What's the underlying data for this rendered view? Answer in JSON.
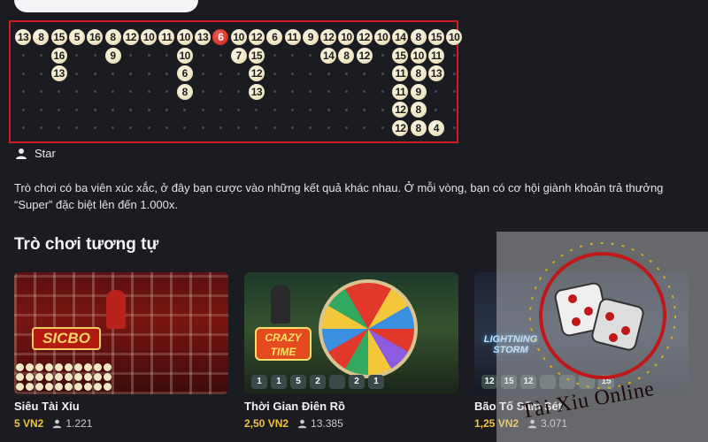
{
  "roadmap": {
    "columns": [
      [
        "13"
      ],
      [
        "8"
      ],
      [
        "15",
        "16",
        "13"
      ],
      [
        "5"
      ],
      [
        "16"
      ],
      [
        "8",
        "9"
      ],
      [
        "12"
      ],
      [
        "10"
      ],
      [
        "11"
      ],
      [
        "10",
        "10",
        "6",
        "8"
      ],
      [
        "13"
      ],
      [
        "6"
      ],
      [
        "10",
        "7"
      ],
      [
        "12",
        "15",
        "12",
        "13"
      ],
      [
        "6"
      ],
      [
        "11"
      ],
      [
        "9"
      ],
      [
        "12",
        "14"
      ],
      [
        "10",
        "8"
      ],
      [
        "12",
        "12"
      ],
      [
        "10"
      ],
      [
        "14",
        "15",
        "11",
        "11",
        "12",
        "12"
      ],
      [
        "8",
        "10",
        "8",
        "9",
        "8",
        "8"
      ],
      [
        "15",
        "11",
        "13",
        "",
        "",
        "4"
      ],
      [
        "10"
      ]
    ],
    "red_values": [
      "6"
    ]
  },
  "game": {
    "star_label": "Star",
    "description": "Trò chơi có ba viên xúc xắc, ở đây bạn cược vào những kết quả khác nhau. Ở mỗi vòng, bạn có cơ hội giành khoản trả thưởng “Super” đặc biệt lên đến 1.000x."
  },
  "similar": {
    "title": "Trò chơi tương tự",
    "cards": [
      {
        "name": "Siêu Tài Xỉu",
        "price": "5 VN2",
        "players": "1.221",
        "logo": "SICBO"
      },
      {
        "name": "Thời Gian Điên Rồ",
        "price": "2,50 VN2",
        "players": "13.385",
        "logo": "CRAZY TIME"
      },
      {
        "name": "Bão Tố Sấm Sét",
        "price": "1,25 VN2",
        "players": "3.071",
        "logo": "LIGHTNING STORM"
      }
    ],
    "crazy_segments": [
      "1",
      "1",
      "5",
      "2",
      "",
      "2",
      "1"
    ],
    "storm_segments": [
      "12",
      "15",
      "12",
      "",
      "",
      "",
      "15"
    ]
  },
  "watermark": {
    "text": "Tài Xỉu Online"
  },
  "colors": {
    "frame": "#d01c22",
    "price": "#f3c33a",
    "chip": "#efe6c4",
    "chip_red": "#d8322a"
  }
}
